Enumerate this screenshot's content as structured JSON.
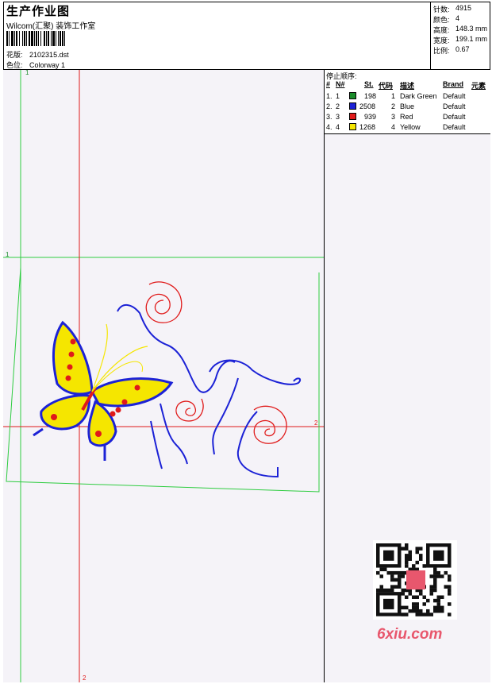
{
  "header": {
    "title": "生产作业图",
    "company": "Wilcom(汇聚) 装饰工作室",
    "design_label": "花版:",
    "design_value": "2102315.dst",
    "colorway_label": "色位:",
    "colorway_value": "Colorway 1"
  },
  "stats": [
    {
      "label": "针数:",
      "value": "4915"
    },
    {
      "label": "颜色:",
      "value": "4"
    },
    {
      "label": "高度:",
      "value": "148.3 mm"
    },
    {
      "label": "宽度:",
      "value": "199.1 mm"
    },
    {
      "label": "比例:",
      "value": "0.67"
    }
  ],
  "stop_sequence": {
    "title": "停止顺序:",
    "columns": [
      "#",
      "N#",
      "St.",
      "代码",
      "描述",
      "Brand",
      "元素"
    ],
    "rows": [
      {
        "num": "1.",
        "n": "1",
        "stitches": "198",
        "code": "1",
        "desc": "Dark Green",
        "brand": "Default",
        "color": "#1a8c2a"
      },
      {
        "num": "2.",
        "n": "2",
        "stitches": "2508",
        "code": "2",
        "desc": "Blue",
        "brand": "Default",
        "color": "#1c22d6"
      },
      {
        "num": "3.",
        "n": "3",
        "stitches": "939",
        "code": "3",
        "desc": "Red",
        "brand": "Default",
        "color": "#e01a1a"
      },
      {
        "num": "4.",
        "n": "4",
        "stitches": "1268",
        "code": "4",
        "desc": "Yellow",
        "brand": "Default",
        "color": "#f5e600"
      }
    ]
  },
  "canvas": {
    "axis_labels": {
      "green_v": "1",
      "green_h": "1",
      "red_h": "2",
      "red_v": "2"
    }
  },
  "watermark": {
    "site": "6xiu.com"
  }
}
